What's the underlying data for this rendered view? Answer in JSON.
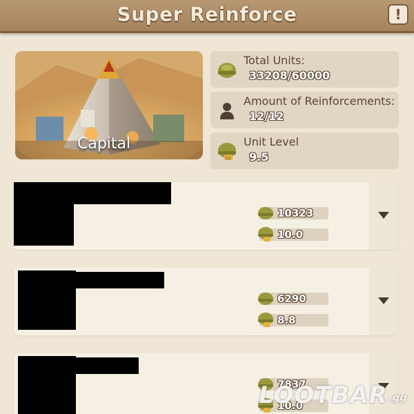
{
  "header": {
    "title": "Super Reinforce",
    "info_label": "!"
  },
  "capital": {
    "label": "Capital"
  },
  "stats": [
    {
      "label": "Total Units:",
      "value": "33208/60000",
      "icon": "helmet-icon"
    },
    {
      "label": "Amount of Reinforcements:",
      "value": "12/12",
      "icon": "person-icon"
    },
    {
      "label": "Unit Level",
      "value": "9.5",
      "icon": "helmet-level-icon"
    }
  ],
  "rows": [
    {
      "units": "10323",
      "level": "10.0"
    },
    {
      "units": "6290",
      "level": "8.8"
    },
    {
      "units": "7837",
      "level": "10.0"
    }
  ],
  "watermark": {
    "brand": "LOOTBAR",
    "suffix": ".gg"
  },
  "colors": {
    "header": "#a6835d",
    "background": "#efe6d6",
    "stat_box": "#e1d6c4",
    "card": "#f5efe4",
    "helmet": "#9a9a3c"
  }
}
